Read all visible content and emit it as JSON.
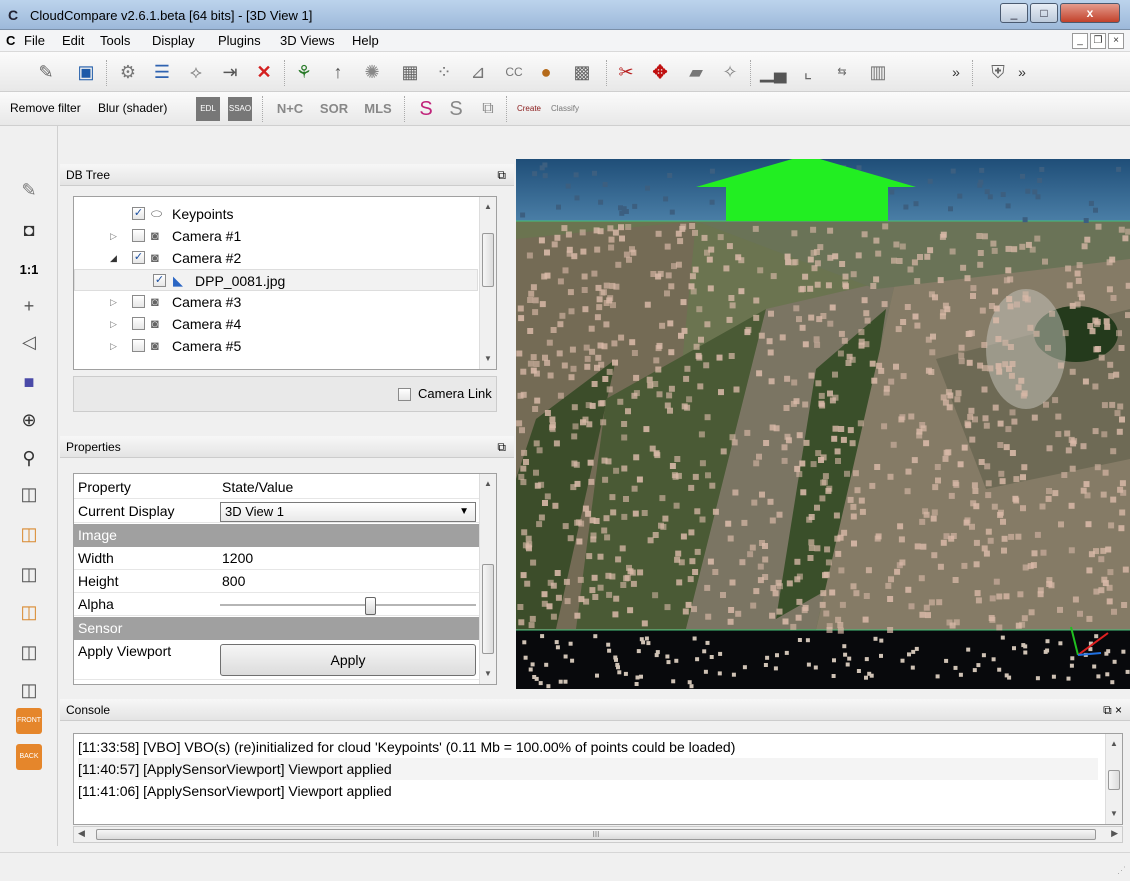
{
  "window": {
    "title": "CloudCompare v2.6.1.beta [64 bits] - [3D View 1]",
    "app_glyph": "C"
  },
  "menubar": {
    "items": [
      "File",
      "Edit",
      "Tools",
      "Display",
      "Plugins",
      "3D Views",
      "Help"
    ]
  },
  "toolbar2": {
    "remove_filter": "Remove filter",
    "blur": "Blur (shader)",
    "edl": "EDL",
    "ssao": "SSAO",
    "nc": "N+C",
    "sor": "SOR",
    "mls": "MLS",
    "canupo_create": "Create",
    "canupo_classify": "Classify"
  },
  "lefttb": {
    "one_to_one": "1:1",
    "front": "FRONT",
    "back": "BACK"
  },
  "dbtree": {
    "title": "DB Tree",
    "items": [
      {
        "label": "Keypoints",
        "checked": true
      },
      {
        "label": "Camera #1",
        "checked": false
      },
      {
        "label": "Camera #2",
        "checked": true
      },
      {
        "label": "DPP_0081.jpg",
        "checked": true
      },
      {
        "label": "Camera #3",
        "checked": false
      },
      {
        "label": "Camera #4",
        "checked": false
      },
      {
        "label": "Camera #5",
        "checked": false
      }
    ],
    "camera_link": "Camera Link"
  },
  "properties": {
    "title": "Properties",
    "header_property": "Property",
    "header_value": "State/Value",
    "current_display_label": "Current Display",
    "current_display_value": "3D View 1",
    "section_image": "Image",
    "width_label": "Width",
    "width_value": "1200",
    "height_label": "Height",
    "height_value": "800",
    "alpha_label": "Alpha",
    "section_sensor": "Sensor",
    "apply_viewport_label": "Apply Viewport",
    "apply_button": "Apply",
    "alpha_level": 0.6
  },
  "console": {
    "title": "Console",
    "lines": [
      "[11:33:58] [VBO] VBO(s) (re)initialized for cloud 'Keypoints' (0.11 Mb = 100.00% of points could be loaded)",
      "[11:40:57] [ApplySensorViewport] Viewport applied",
      "[11:41:06] [ApplySensorViewport] Viewport applied"
    ],
    "scroll_mark": "III"
  },
  "colors": {
    "accent": "#1b4fa0",
    "green_arrow": "#22ee22",
    "section_gray": "#a0a0a0"
  }
}
